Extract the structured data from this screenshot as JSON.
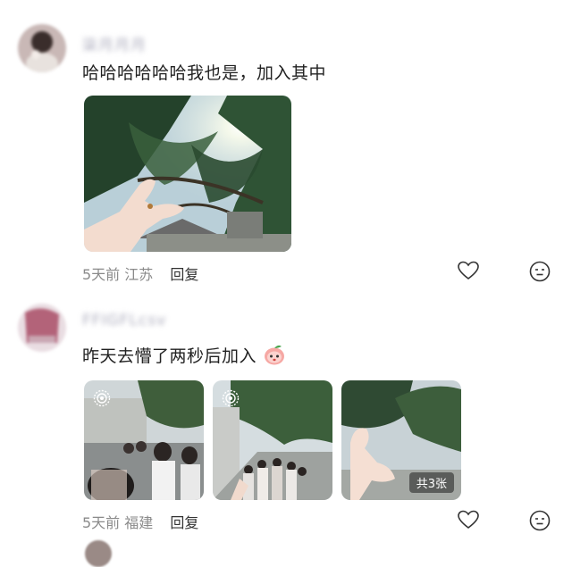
{
  "comments": [
    {
      "username": "柒月月月",
      "text": "哈哈哈哈哈哈我也是，加入其中",
      "time": "5天前",
      "location": "江苏",
      "reply_label": "回复",
      "images": [
        {
          "description": "photo of a hand making a heart shape against trees and sun"
        }
      ]
    },
    {
      "username": "FFIGFLcsv",
      "text": "昨天去懵了两秒后加入",
      "emoji": "peach-face-emoji",
      "time": "5天前",
      "location": "福建",
      "reply_label": "回复",
      "images": [
        {
          "live": true
        },
        {
          "live": true
        },
        {
          "count_label": "共3张"
        }
      ]
    }
  ],
  "icons": [
    "heart-icon",
    "emoji-reaction-icon",
    "live-photo-icon"
  ]
}
